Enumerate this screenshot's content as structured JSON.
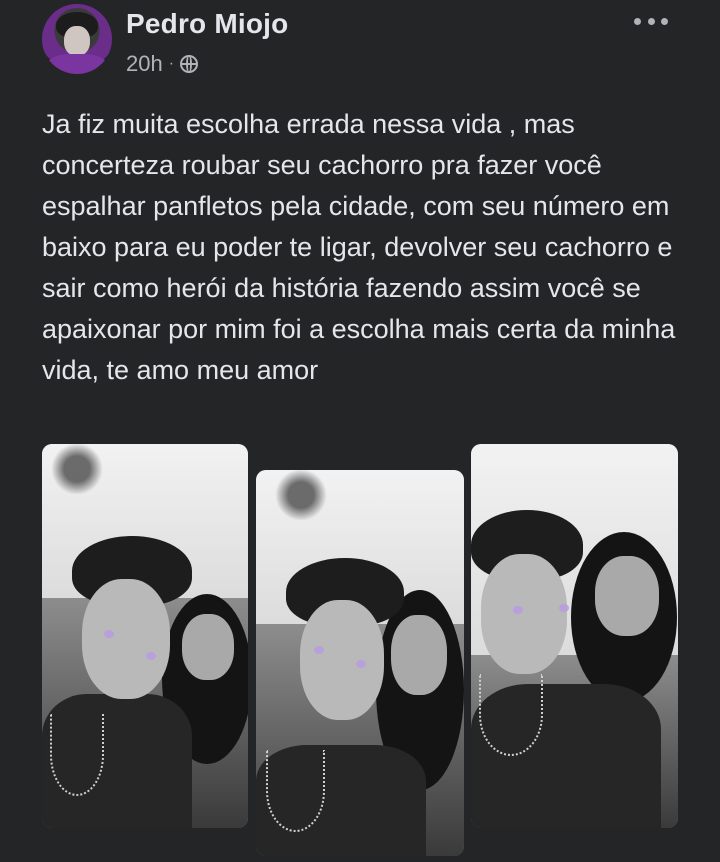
{
  "post": {
    "author": "Pedro Miojo",
    "time": "20h",
    "separator": "·",
    "privacy_icon": "globe-icon",
    "more_icon": "more-options-icon",
    "text": "Ja fiz muita escolha errada nessa vida , mas concerteza roubar seu cachorro pra fazer você espalhar panfletos pela cidade, com seu número em baixo para eu poder te ligar, devolver seu cachorro e sair como herói da história fazendo assim você se apaixonar por mim foi a escolha mais certa da minha vida, te amo meu amor"
  },
  "theme": {
    "background": "#242526",
    "text": "#e4e6eb",
    "muted": "#b0b3b8"
  }
}
